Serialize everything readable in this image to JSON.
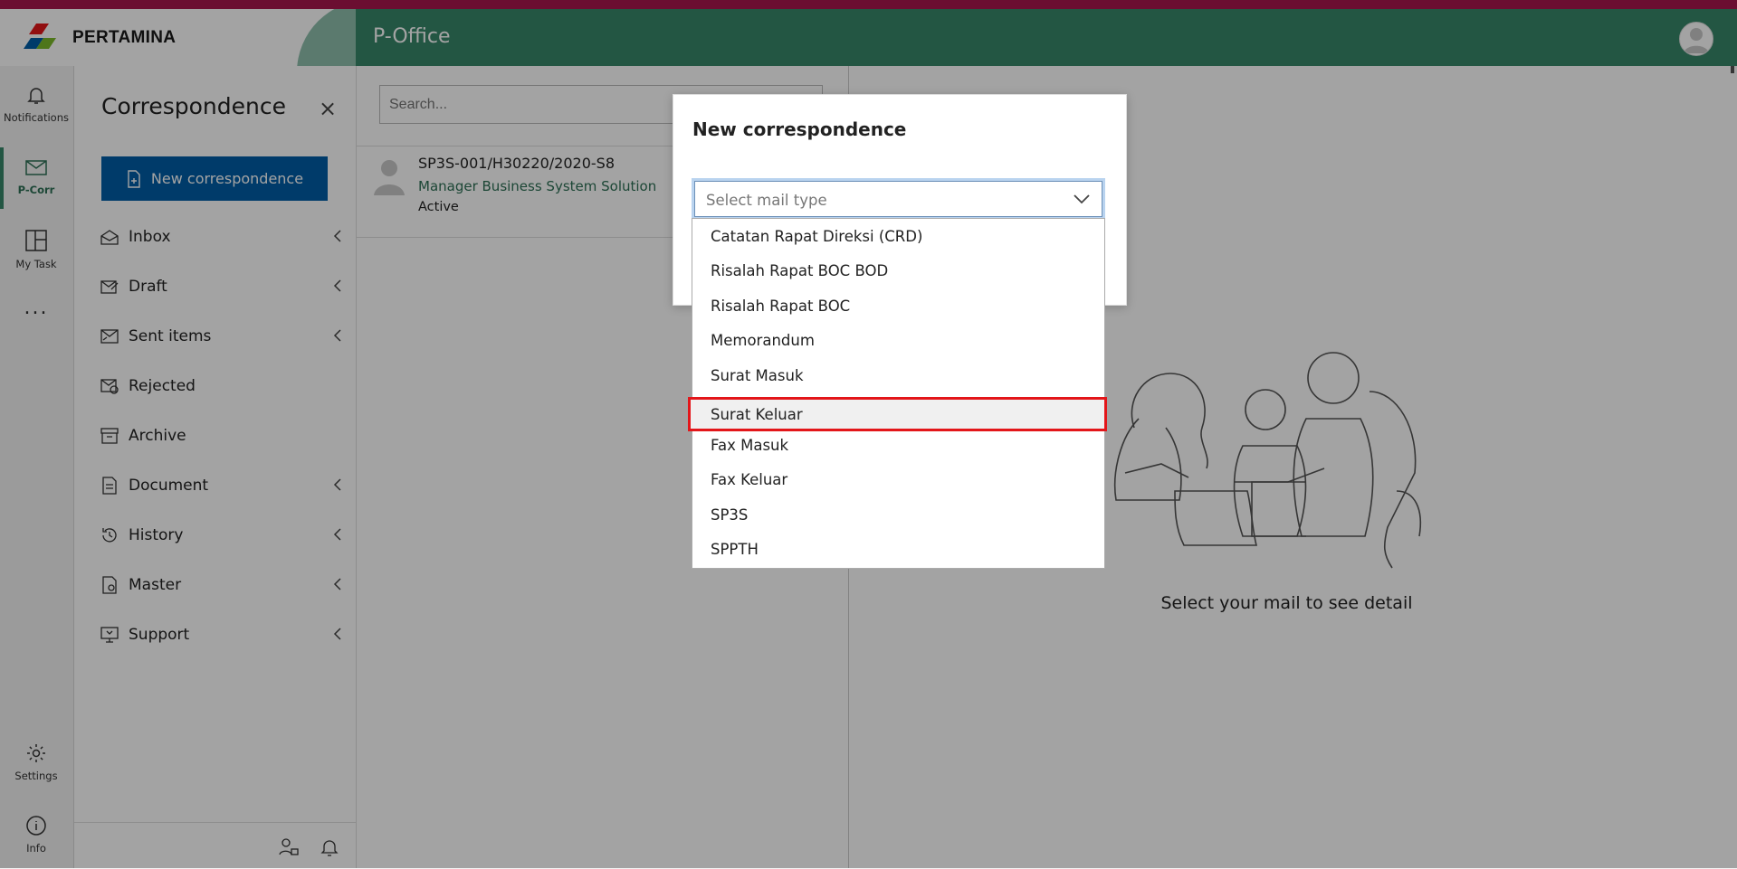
{
  "header": {
    "logo_text": "PERTAMINA",
    "app_title": "P-Office"
  },
  "rail": {
    "items": [
      {
        "label": "Notifications",
        "icon": "bell-icon"
      },
      {
        "label": "P-Corr",
        "icon": "mail-icon",
        "active": true
      },
      {
        "label": "My Task",
        "icon": "task-icon"
      },
      {
        "label": "...",
        "icon": "more-icon"
      },
      {
        "label": "Settings",
        "icon": "gear-icon"
      },
      {
        "label": "Info",
        "icon": "info-icon"
      }
    ]
  },
  "sidebar": {
    "title": "Correspondence",
    "close_label": "×",
    "new_button": "New correspondence",
    "items": [
      {
        "label": "Inbox",
        "icon": "inbox-icon",
        "expandable": true
      },
      {
        "label": "Draft",
        "icon": "draft-icon",
        "expandable": true
      },
      {
        "label": "Sent items",
        "icon": "sent-icon",
        "expandable": true
      },
      {
        "label": "Rejected",
        "icon": "rejected-icon",
        "expandable": false
      },
      {
        "label": "Archive",
        "icon": "archive-icon",
        "expandable": false
      },
      {
        "label": "Document",
        "icon": "document-icon",
        "expandable": true
      },
      {
        "label": "History",
        "icon": "history-icon",
        "expandable": true
      },
      {
        "label": "Master",
        "icon": "master-icon",
        "expandable": true
      },
      {
        "label": "Support",
        "icon": "support-icon",
        "expandable": true
      }
    ]
  },
  "mail_list": {
    "search_placeholder": "Search...",
    "items": [
      {
        "number": "SP3S-001/H30220/2020-S8",
        "position": "Manager Business System Solution",
        "status": "Active"
      }
    ]
  },
  "detail": {
    "empty_text": "Select your mail to see detail"
  },
  "modal": {
    "title": "New correspondence",
    "select_placeholder": "Select mail type",
    "options": [
      "Catatan Rapat Direksi (CRD)",
      "Risalah Rapat BOC BOD",
      "Risalah Rapat BOC",
      "Memorandum",
      "Surat Masuk",
      "Surat Keluar",
      "Fax Masuk",
      "Fax Keluar",
      "SP3S",
      "SPPTH"
    ],
    "highlighted_option": "Surat Keluar"
  },
  "colors": {
    "header_green": "#37876a",
    "primary_blue": "#005da6",
    "accent_red": "#e3161a",
    "top_strip": "#a8174e"
  }
}
